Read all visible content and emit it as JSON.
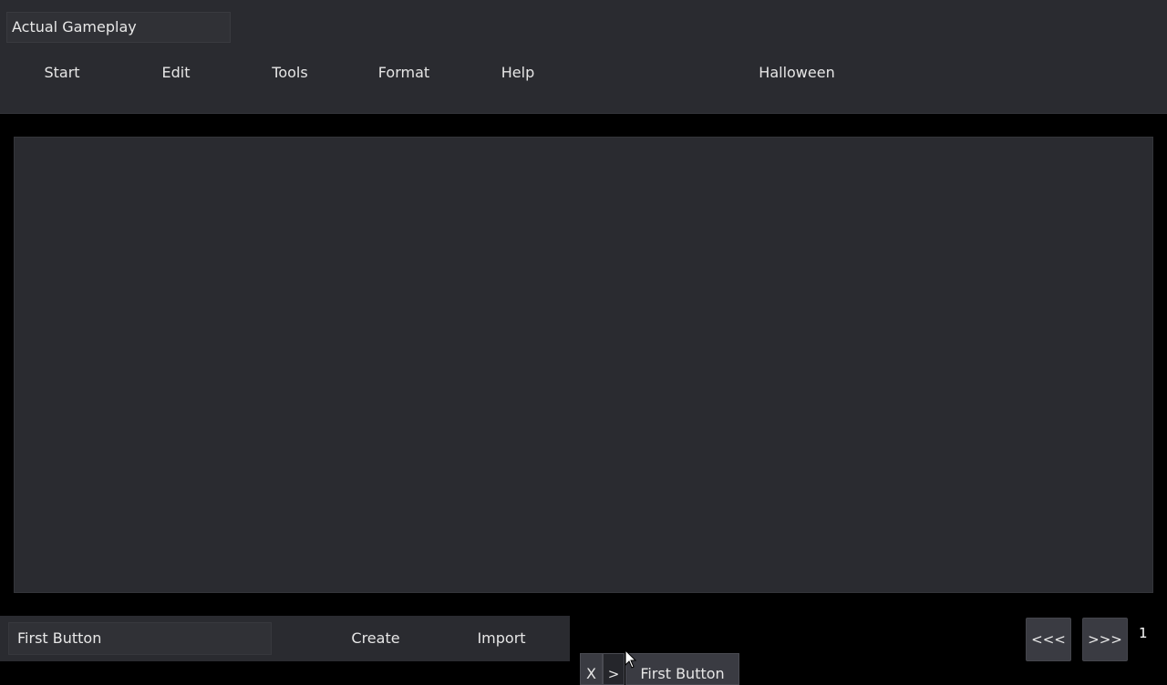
{
  "window": {
    "title": "Actual Gameplay"
  },
  "menu": {
    "items": [
      "Start",
      "Edit",
      "Tools",
      "Format",
      "Help"
    ],
    "theme_label": "Halloween"
  },
  "bottom_bar": {
    "name_value": "First Button",
    "create_label": "Create",
    "import_label": "Import"
  },
  "pager": {
    "prev_label": "<<<",
    "next_label": ">>>",
    "page": "1"
  },
  "tab": {
    "close_label": "X",
    "arrow_label": ">",
    "label": "First Button"
  },
  "colors": {
    "background": "#000000",
    "panel": "#2a2b30",
    "button": "#3a3b42",
    "text": "#e6e6e6"
  }
}
